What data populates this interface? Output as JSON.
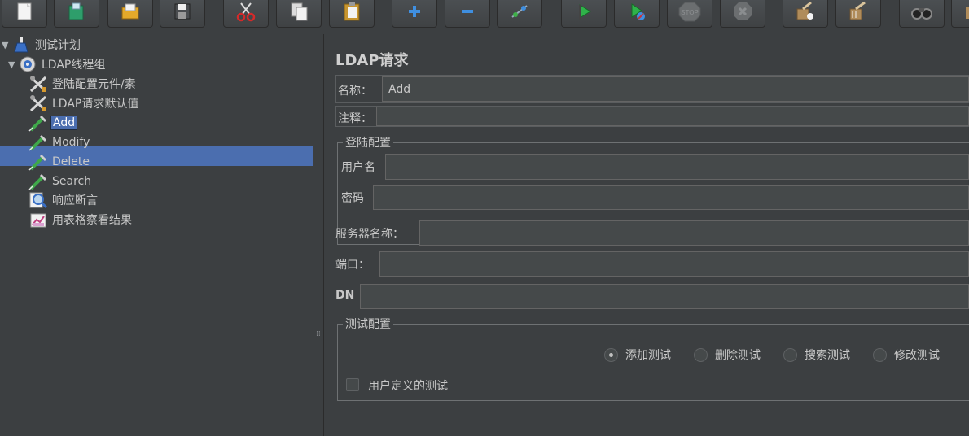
{
  "toolbar": {
    "buttons": [
      {
        "name": "new-icon"
      },
      {
        "name": "templates-icon"
      },
      {
        "name": "open-icon"
      },
      {
        "name": "save-icon"
      },
      {
        "name": "cut-icon"
      },
      {
        "name": "copy-icon"
      },
      {
        "name": "paste-icon"
      },
      {
        "name": "expand-icon"
      },
      {
        "name": "collapse-icon"
      },
      {
        "name": "toggle-icon"
      },
      {
        "name": "start-icon"
      },
      {
        "name": "start-no-pause-icon"
      },
      {
        "name": "stop-icon"
      },
      {
        "name": "shutdown-icon"
      },
      {
        "name": "clear-icon"
      },
      {
        "name": "clear-all-icon"
      },
      {
        "name": "search-icon"
      },
      {
        "name": "reset-search-icon"
      }
    ],
    "stop_text": "STOP"
  },
  "tree": {
    "items": [
      {
        "label": "测试计划",
        "icon": "test-plan-icon"
      },
      {
        "label": "LDAP线程组",
        "icon": "thread-group-icon"
      },
      {
        "label": "登陆配置元件/素",
        "icon": "config-element-icon"
      },
      {
        "label": "LDAP请求默认值",
        "icon": "config-element-icon"
      },
      {
        "label": "Add",
        "icon": "sampler-icon",
        "selected": true
      },
      {
        "label": "Modify",
        "icon": "sampler-icon"
      },
      {
        "label": "Delete",
        "icon": "sampler-icon"
      },
      {
        "label": "Search",
        "icon": "sampler-icon"
      },
      {
        "label": "响应断言",
        "icon": "assertion-icon"
      },
      {
        "label": "用表格察看结果",
        "icon": "listener-icon"
      }
    ]
  },
  "form": {
    "title": "LDAP请求",
    "name_label": "名称：",
    "name_value": "Add",
    "comment_label": "注释：",
    "comment_value": "",
    "login_group": {
      "title": "登陆配置",
      "username_label": "用户名",
      "username_value": "",
      "password_label": "密码",
      "password_value": ""
    },
    "server_label": "服务器名称：",
    "server_value": "",
    "port_label": "端口：",
    "port_value": "",
    "dn_label": "DN",
    "dn_value": "",
    "test_group": {
      "title": "测试配置",
      "radios": [
        {
          "label": "添加测试",
          "checked": true
        },
        {
          "label": "删除测试",
          "checked": false
        },
        {
          "label": "搜索测试",
          "checked": false
        },
        {
          "label": "修改测试",
          "checked": false
        }
      ],
      "user_defined_label": "用户定义的测试",
      "user_defined_checked": false
    }
  }
}
